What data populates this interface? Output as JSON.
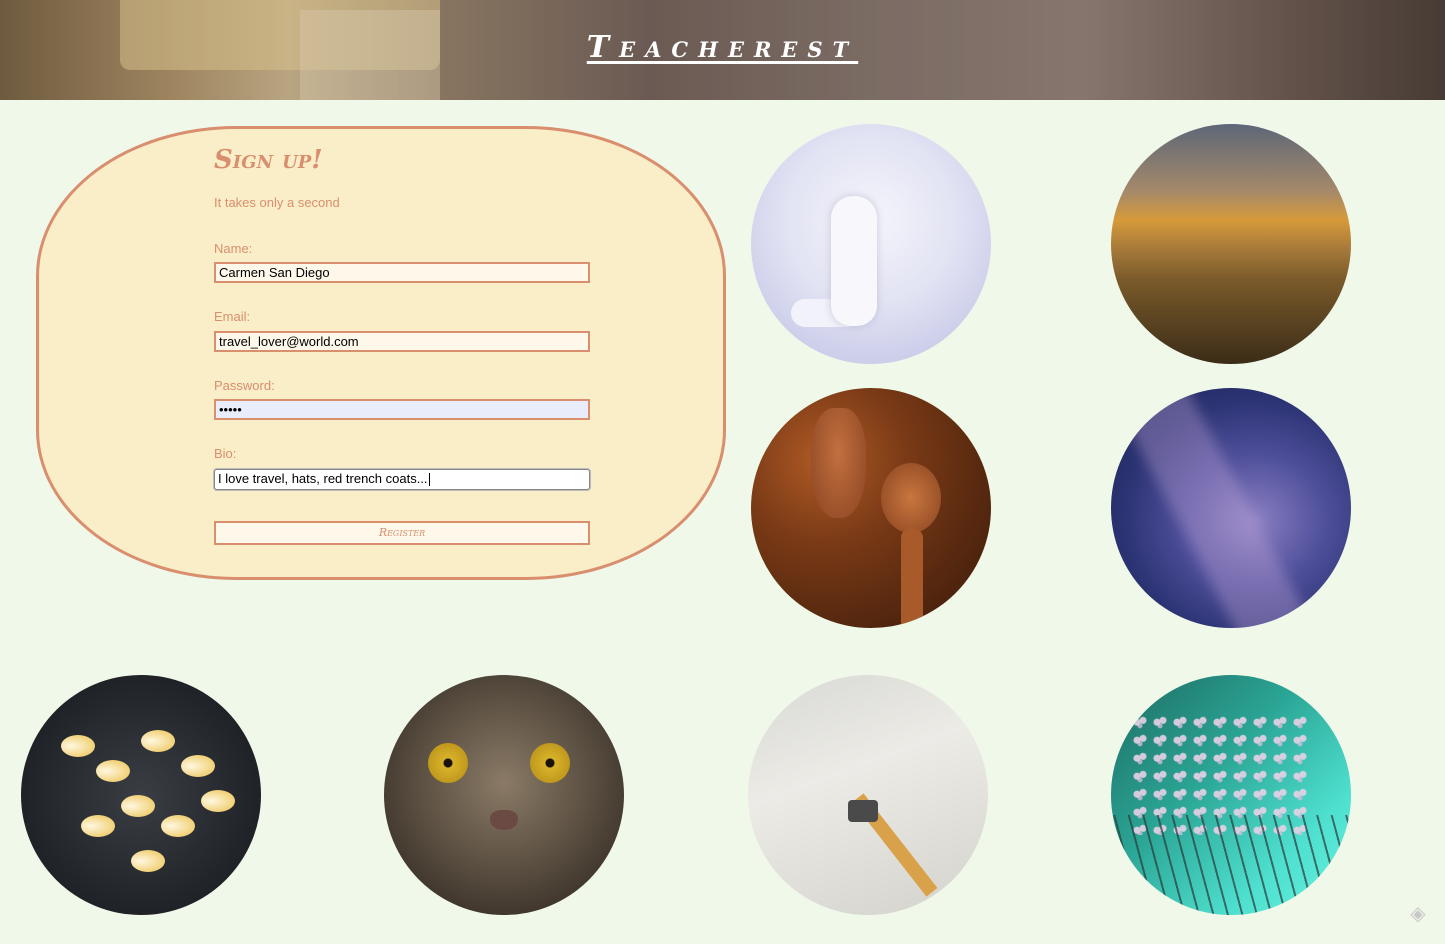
{
  "header": {
    "title": "Teacherest"
  },
  "signup": {
    "heading": "Sign up!",
    "subtitle": "It takes only a second",
    "fields": [
      {
        "label": "Name:",
        "value": "Carmen San Diego"
      },
      {
        "label": "Email:",
        "value": "travel_lover@world.com"
      },
      {
        "label": "Password:",
        "value": "•••••"
      },
      {
        "label": "Bio:",
        "value": "I love travel, hats, red trench coats..."
      }
    ],
    "register_label": "Register"
  },
  "gallery": {
    "images": [
      "arctic-fox",
      "mountain-landscape",
      "star-anise-spoons",
      "milky-way",
      "plumeria-flowers",
      "tabby-cat",
      "notebook-pencil-shavings",
      "dandelion-dew"
    ]
  },
  "icons": {
    "feedback": "feedback-icon"
  }
}
